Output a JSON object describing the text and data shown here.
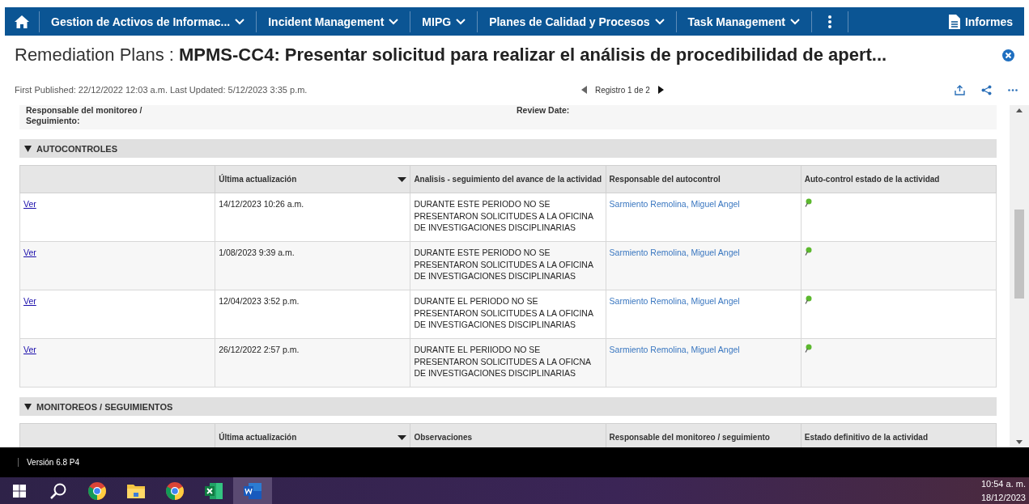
{
  "nav": {
    "items": [
      {
        "label": "Gestion de Activos de Informac...",
        "kind": "menu"
      },
      {
        "label": "Incident Management",
        "kind": "menu"
      },
      {
        "label": "MIPG",
        "kind": "menu"
      },
      {
        "label": "Planes de Calidad y Procesos",
        "kind": "menu"
      },
      {
        "label": "Task Management",
        "kind": "menu"
      }
    ],
    "reports": "Informes"
  },
  "header": {
    "module": "Remediation Plans",
    "separator": ":",
    "record_title": "MPMS-CC4: Presentar solicitud para realizar el análisis de procedibilidad de apert...",
    "meta": "First Published: 22/12/2022 12:03 a.m. Last Updated: 5/12/2023 3:35 p.m.",
    "pager": "Registro 1 de 2"
  },
  "fields": [
    {
      "label": "Responsable del monitoreo / Seguimiento:"
    },
    {
      "label": "Review Date:"
    }
  ],
  "sections": [
    {
      "title": "AUTOCONTROLES",
      "expanded": true,
      "columns": [
        {
          "sorted": false
        },
        {
          "label": "Última actualización",
          "sorted": true
        },
        {
          "label": "Analisis - seguimiento del avance de la actividad",
          "sorted": false
        },
        {
          "label": "Responsable del autocontrol",
          "sorted": false
        },
        {
          "label": "Auto-control estado de la actividad",
          "sorted": false
        }
      ],
      "rows": [
        {
          "link": "Ver",
          "date": "14/12/2023 10:26 a.m.",
          "analysis": "DURANTE ESTE PERIODO NO SE PRESENTARON SOLICITUDES A LA OFICINA DE INVESTIGACIONES DISCIPLINARIAS",
          "owner": "Sarmiento Remolina, Miguel Angel",
          "color": "#5cb82e"
        },
        {
          "link": "Ver",
          "date": "1/08/2023 9:39 a.m.",
          "analysis": "DURANTE ESTE PERIODO NO SE PRESENTARON SOLICITUDES A LA OFICINA DE INVESTIGACIONES DISCIPLINARIAS",
          "owner": "Sarmiento Remolina, Miguel Angel",
          "color": "#5cb82e"
        },
        {
          "link": "Ver",
          "date": "12/04/2023 3:52 p.m.",
          "analysis": "DURANTE EL PERIODO NO SE PRESENTARON SOLICITUDES A LA OFICINA DE INVESTIGACIONES DISCIPLINARIAS",
          "owner": "Sarmiento Remolina, Miguel Angel",
          "color": "#5cb82e"
        },
        {
          "link": "Ver",
          "date": "26/12/2022 2:57 p.m.",
          "analysis": "DURANTE EL PERIIODO NO SE PRESENTARON SOLICITUDES A LA OFICNA DE INVESTIGACIONES DISCIPLINARIAS",
          "owner": "Sarmiento Remolina, Miguel Angel",
          "color": "#5cb82e"
        }
      ]
    },
    {
      "title": "MONITOREOS / SEGUIMIENTOS",
      "expanded": true,
      "columns": [
        {
          "sorted": false
        },
        {
          "label": "Última actualización",
          "sorted": true
        },
        {
          "label": "Observaciones",
          "sorted": false
        },
        {
          "label": "Responsable del monitoreo / seguimiento",
          "sorted": false
        },
        {
          "label": "Estado definitivo de la actividad",
          "sorted": false
        }
      ]
    }
  ],
  "footer": {
    "version": "Versión 6.8 P4"
  },
  "taskbar": {
    "apps": [
      {
        "kind": "search",
        "selected": false
      },
      {
        "kind": "chrome",
        "selected": false
      },
      {
        "kind": "folder",
        "selected": false
      },
      {
        "kind": "chrome",
        "selected": false
      },
      {
        "kind": "excel",
        "selected": false
      },
      {
        "kind": "word",
        "selected": true
      }
    ],
    "time": "10:54 a. m.",
    "date": "18/12/2023"
  }
}
